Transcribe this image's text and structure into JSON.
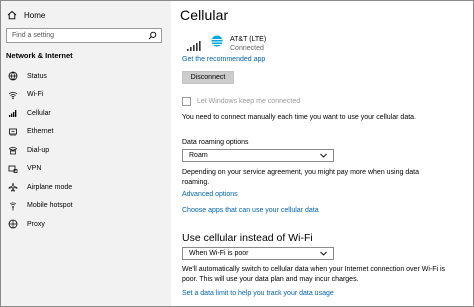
{
  "sidebar": {
    "home_label": "Home",
    "search_placeholder": "Find a setting",
    "section_title": "Network & Internet",
    "items": [
      {
        "label": "Status",
        "icon": "globe-icon"
      },
      {
        "label": "Wi-Fi",
        "icon": "wifi-icon"
      },
      {
        "label": "Cellular",
        "icon": "cellular-signal-icon",
        "active": true
      },
      {
        "label": "Ethernet",
        "icon": "ethernet-icon"
      },
      {
        "label": "Dial-up",
        "icon": "dial-up-icon"
      },
      {
        "label": "VPN",
        "icon": "vpn-icon"
      },
      {
        "label": "Airplane mode",
        "icon": "airplane-icon"
      },
      {
        "label": "Mobile hotspot",
        "icon": "hotspot-icon"
      },
      {
        "label": "Proxy",
        "icon": "globe-proxy-icon"
      }
    ]
  },
  "main": {
    "title": "Cellular",
    "carrier": {
      "name": "AT&T (LTE)",
      "status": "Connected"
    },
    "recommended_app_link": "Get the recommended app",
    "disconnect_button": "Disconnect",
    "keep_connected_checkbox": {
      "label": "Let Windows keep me connected",
      "checked": false,
      "enabled": false
    },
    "manual_connect_note": "You need to connect manually each time you want to use your cellular data.",
    "roaming": {
      "label": "Data roaming options",
      "value": "Roam",
      "note": "Depending on your service agreement, you might pay more when using data roaming."
    },
    "advanced_options_link": "Advanced options",
    "choose_apps_link": "Choose apps that can use your cellular data",
    "wifi_section": {
      "heading": "Use cellular instead of Wi-Fi",
      "value": "When Wi-Fi is poor",
      "note": "We'll automatically switch to cellular data when your Internet connection over Wi-Fi is poor. This will use your data plan and may incur charges.",
      "data_limit_link": "Set a data limit to help you track your data usage"
    }
  },
  "colors": {
    "link": "#0063b1",
    "sidebar_bg": "#f2f2f2",
    "button_bg": "#cccccc",
    "disabled_text": "#9a9a9a"
  }
}
